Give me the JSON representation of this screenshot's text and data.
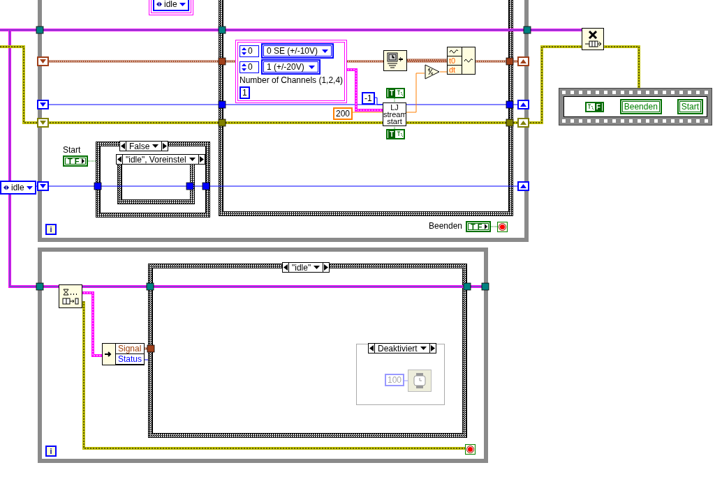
{
  "top_loop": {
    "nodes": [
      {
        "kind": "cluster",
        "children": [
          {
            "kind": "enum",
            "value": "idle"
          }
        ]
      },
      {
        "kind": "enum",
        "value": "idle"
      },
      {
        "kind": "label",
        "text": "Start"
      },
      {
        "kind": "bool_control",
        "value": "T F"
      },
      {
        "kind": "selector",
        "value": "False"
      },
      {
        "kind": "selector",
        "value": "\"idle\", Voreinstel"
      },
      {
        "kind": "cluster",
        "children": [
          {
            "kind": "ring_row",
            "index": "0",
            "value": "0 SE (+/-10V)"
          },
          {
            "kind": "ring_row",
            "index": "0",
            "value": "1 (+/-20V)"
          },
          {
            "kind": "label",
            "text": "Number of Channels (1,2,4)"
          },
          {
            "kind": "numeric",
            "color": "#0000ff",
            "disabled": false,
            "value": "1"
          }
        ]
      },
      {
        "kind": "timestamp"
      },
      {
        "kind": "build_waveform",
        "terminals": [
          "t0",
          "dt"
        ]
      },
      {
        "kind": "reciprocal"
      },
      {
        "kind": "numeric",
        "color": "#0000ff",
        "disabled": false,
        "value": "-1"
      },
      {
        "kind": "bool_const",
        "value": "T"
      },
      {
        "kind": "numeric",
        "color": "#ff7f00",
        "disabled": false,
        "value": "200"
      },
      {
        "kind": "subvi",
        "text": "LJ stream start"
      },
      {
        "kind": "bool_const",
        "value": "T"
      },
      {
        "kind": "label",
        "text": "Beenden"
      },
      {
        "kind": "bool_control",
        "value": "T F"
      },
      {
        "kind": "stop"
      },
      {
        "kind": "iteration",
        "text": "i"
      }
    ]
  },
  "queue_release": {
    "nodes": [
      {
        "kind": "release_queue"
      },
      {
        "kind": "sequence",
        "children": [
          {
            "kind": "bool_const",
            "value": "F"
          },
          {
            "kind": "string",
            "value": "Beenden"
          },
          {
            "kind": "string",
            "value": "Start"
          }
        ]
      }
    ]
  },
  "bottom_loop": {
    "nodes": [
      {
        "kind": "dequeue"
      },
      {
        "kind": "selector",
        "value": "\"idle\""
      },
      {
        "kind": "unbundle",
        "elements": [
          {
            "text": "Signal",
            "color": "#a0400a"
          },
          {
            "text": "Status",
            "color": "#0000ff"
          }
        ]
      },
      {
        "kind": "selector",
        "value": "Deaktiviert"
      },
      {
        "kind": "numeric",
        "color": "#9999ff",
        "disabled": true,
        "value": "100"
      },
      {
        "kind": "wait"
      },
      {
        "kind": "iteration",
        "text": "i"
      },
      {
        "kind": "stop"
      }
    ]
  }
}
